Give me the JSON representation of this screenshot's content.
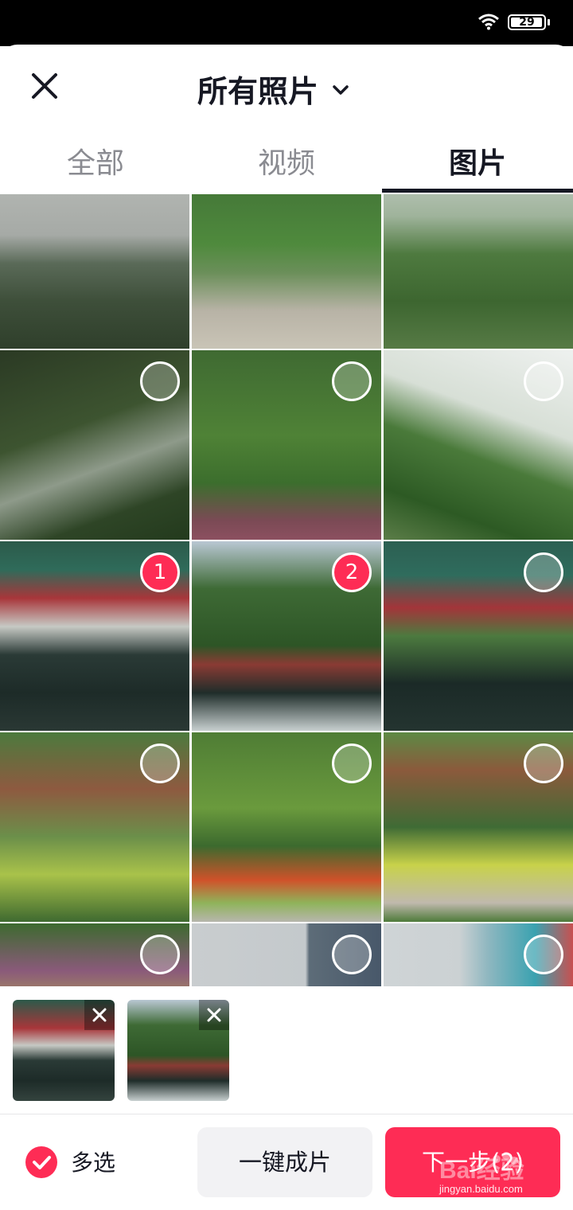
{
  "status_bar": {
    "battery": "29",
    "wifi_icon": "wifi-icon"
  },
  "header": {
    "title": "所有照片",
    "close_icon": "close-icon",
    "dropdown_icon": "chevron-down-icon"
  },
  "tabs": [
    {
      "label": "全部",
      "active": false
    },
    {
      "label": "视频",
      "active": false
    },
    {
      "label": "图片",
      "active": true
    }
  ],
  "grid": {
    "selected": [
      {
        "order": "1"
      },
      {
        "order": "2"
      }
    ]
  },
  "tray": {
    "remove_icon": "close-icon"
  },
  "footer": {
    "multi_select_label": "多选",
    "one_click_label": "一键成片",
    "next_label": "下一步(2)"
  },
  "colors": {
    "accent": "#fe2c55",
    "text_primary": "#161823",
    "text_secondary": "#8a8b91"
  },
  "watermark": {
    "text": "jingyan.baidu.com",
    "logo": "Bai经验"
  }
}
